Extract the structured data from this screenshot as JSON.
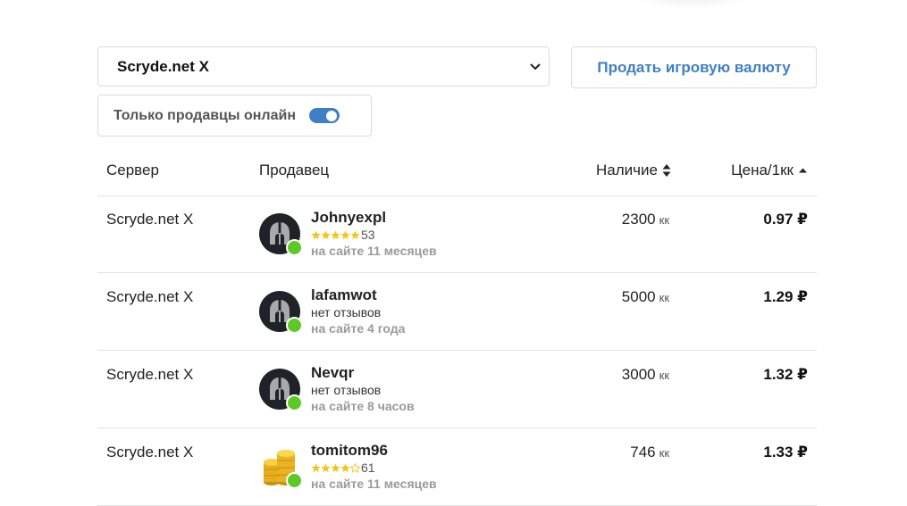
{
  "filters": {
    "server_value": "Scryde.net X",
    "sell_button": "Продать игровую валюту",
    "online_only_label": "Только продавцы онлайн",
    "online_only_on": true
  },
  "table": {
    "headers": {
      "server": "Сервер",
      "seller": "Продавец",
      "stock": "Наличие",
      "price": "Цена/1кк"
    },
    "unit": "кк",
    "rows": [
      {
        "server": "Scryde.net X",
        "seller": "Johnyexpl",
        "avatar": "spartan-helmet-icon",
        "stars": 5,
        "reviews": "53",
        "since": "на сайте 11 месяцев",
        "stock": "2300",
        "price": "0.97 ₽",
        "online": true
      },
      {
        "server": "Scryde.net X",
        "seller": "lafamwot",
        "avatar": "spartan-helmet-icon",
        "reviews_text": "нет отзывов",
        "since": "на сайте 4 года",
        "stock": "5000",
        "price": "1.29 ₽",
        "online": true
      },
      {
        "server": "Scryde.net X",
        "seller": "Nevqr",
        "avatar": "spartan-helmet-icon",
        "reviews_text": "нет отзывов",
        "since": "на сайте 8 часов",
        "stock": "3000",
        "price": "1.32 ₽",
        "online": true
      },
      {
        "server": "Scryde.net X",
        "seller": "tomitom96",
        "avatar": "gold-coins-icon",
        "stars": 4,
        "reviews": "61",
        "since": "на сайте 11 месяцев",
        "stock": "746",
        "price": "1.33 ₽",
        "online": true
      }
    ]
  },
  "colors": {
    "accent": "#3f7fc6",
    "online": "#5cc927",
    "star": "#f5c518"
  }
}
